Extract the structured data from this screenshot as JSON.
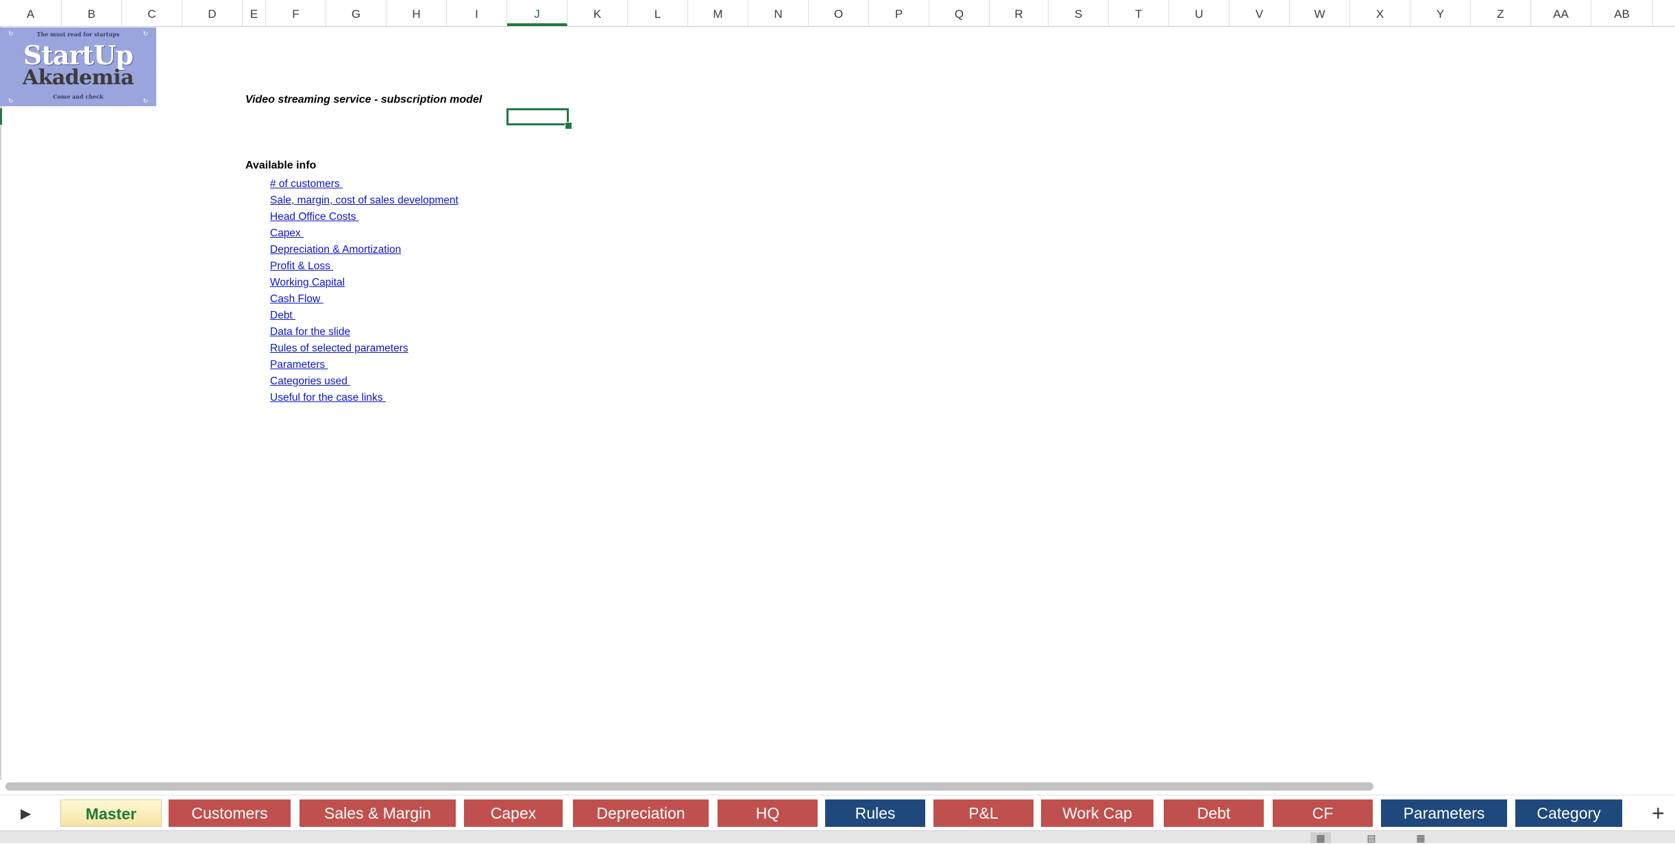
{
  "columns": [
    {
      "label": "A"
    },
    {
      "label": "B"
    },
    {
      "label": "C"
    },
    {
      "label": "D"
    },
    {
      "label": "E"
    },
    {
      "label": "F"
    },
    {
      "label": "G"
    },
    {
      "label": "H"
    },
    {
      "label": "I"
    },
    {
      "label": "J"
    },
    {
      "label": "K"
    },
    {
      "label": "L"
    },
    {
      "label": "M"
    },
    {
      "label": "N"
    },
    {
      "label": "O"
    },
    {
      "label": "P"
    },
    {
      "label": "Q"
    },
    {
      "label": "R"
    },
    {
      "label": "S"
    },
    {
      "label": "T"
    },
    {
      "label": "U"
    },
    {
      "label": "V"
    },
    {
      "label": "W"
    },
    {
      "label": "X"
    },
    {
      "label": "Y"
    },
    {
      "label": "Z"
    },
    {
      "label": "AA"
    },
    {
      "label": "AB"
    }
  ],
  "active_column": "J",
  "logo": {
    "tagline": "The must read for startups",
    "line1": "StartUp",
    "line2": "Akademia",
    "footer": "Come and check"
  },
  "sheet": {
    "title": "Video streaming service - subscription model",
    "available_info_heading": "Available info",
    "links": [
      "# of customers ",
      "Sale, margin, cost of sales development",
      "Head Office Costs ",
      "Capex ",
      "Depreciation & Amortization",
      "Profit & Loss ",
      "Working Capital",
      "Cash Flow ",
      "Debt ",
      "Data for the slide",
      "Rules of selected parameters",
      "Parameters ",
      "Categories used ",
      "Useful for the case links "
    ]
  },
  "tabs": {
    "nav_icon": "play-right-icon",
    "items": [
      {
        "label": "Master",
        "style": "active"
      },
      {
        "label": "Customers",
        "style": "red"
      },
      {
        "label": "Sales & Margin",
        "style": "red"
      },
      {
        "label": "Capex",
        "style": "red"
      },
      {
        "label": "Depreciation",
        "style": "red"
      },
      {
        "label": "HQ",
        "style": "red"
      },
      {
        "label": "Rules",
        "style": "blue"
      },
      {
        "label": "P&L",
        "style": "red"
      },
      {
        "label": "Work Cap",
        "style": "red"
      },
      {
        "label": "Debt",
        "style": "red"
      },
      {
        "label": "CF",
        "style": "red"
      },
      {
        "label": "Parameters",
        "style": "blue"
      },
      {
        "label": "Category",
        "style": "blue"
      }
    ],
    "add_icon": "plus-icon"
  },
  "colors": {
    "tab_red": "#c0504d",
    "tab_blue": "#1f497d",
    "link": "#0b16cc",
    "selection": "#1f7a43"
  }
}
